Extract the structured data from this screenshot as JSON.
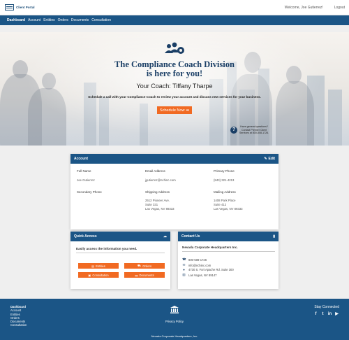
{
  "brand": {
    "logo_text": "Client Portal"
  },
  "topbar": {
    "welcome": "Welcome, Joe Gutierrez!",
    "logout": "Logout"
  },
  "nav": {
    "items": [
      "Dashboard",
      "Account",
      "Entities",
      "Orders",
      "Documents",
      "Consultation"
    ]
  },
  "hero": {
    "title_line1": "The Compliance Coach Division",
    "title_line2": "is here for you!",
    "coach": "Your Coach: Tiffany Tharpe",
    "description": "Schedule a call with your Compliance Coach to review your account and discuss new services for your business.",
    "button": "Schedule Now",
    "help_line1": "Have general questions?",
    "help_line2": "Contact Premier Client",
    "help_line3": "Services at 800-508-1726."
  },
  "account": {
    "header": "Account",
    "edit": "Edit",
    "full_name_label": "Full Name",
    "full_name": "Joe Gutierrez",
    "email_label": "Email Address",
    "email": "jgutierrez@nchinc.com",
    "phone_label": "Primary Phone",
    "phone": "(843) 321-4213",
    "secondary_label": "Secondary Phone",
    "shipping_label": "Shipping Address",
    "shipping": "2512 Pioneer Ave.\nSuite 331\nLas Vegas, NV 89333",
    "mailing_label": "Mailing Address",
    "mailing": "1408 Park Place\nSuite 412\nLas Vegas, NV 89333"
  },
  "quick_access": {
    "header": "Quick Access",
    "label": "Easily access the information you need.",
    "buttons": [
      "Entities",
      "Orders",
      "Consultation",
      "Documents"
    ]
  },
  "contact": {
    "header": "Contact Us",
    "title": "Nevada Corporate Headquarters Inc.",
    "phone": "800-508-1726",
    "email": "info@nchinc.com",
    "address1": "4730 S. Fort Apache Rd. Suite 300",
    "address2": "Las Vegas, NV 89147"
  },
  "footer": {
    "links": [
      "Dashboard",
      "Account",
      "Entities",
      "Orders",
      "Documents",
      "Consultation"
    ],
    "privacy": "Privacy Policy",
    "stay": "Stay Connected",
    "copyright": "Nevada Corporate Headquarters, Inc."
  },
  "colors": {
    "primary": "#1b5586",
    "accent": "#f16a22",
    "title": "#1b3f66"
  }
}
